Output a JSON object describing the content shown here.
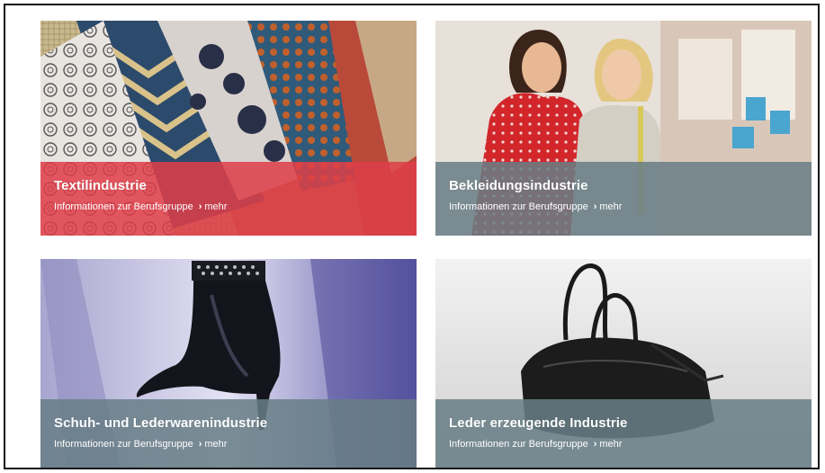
{
  "cards": [
    {
      "title": "Textilindustrie",
      "subtitle": "Informationen zur Berufsgruppe",
      "link": "mehr",
      "image": "textile-fabrics-image",
      "caption_color": "#de3e48"
    },
    {
      "title": "Bekleidungsindustrie",
      "subtitle": "Informationen zur Berufsgruppe",
      "link": "mehr",
      "image": "two-women-fitting-image",
      "caption_color": "#687e86"
    },
    {
      "title": "Schuh- und Lederwarenindustrie",
      "subtitle": "Informationen zur Berufsgruppe",
      "link": "mehr",
      "image": "high-heel-boot-image",
      "caption_color": "#687e86"
    },
    {
      "title": "Leder erzeugende Industrie",
      "subtitle": "Informationen zur Berufsgruppe",
      "link": "mehr",
      "image": "leather-handbag-image",
      "caption_color": "#687e86"
    }
  ]
}
